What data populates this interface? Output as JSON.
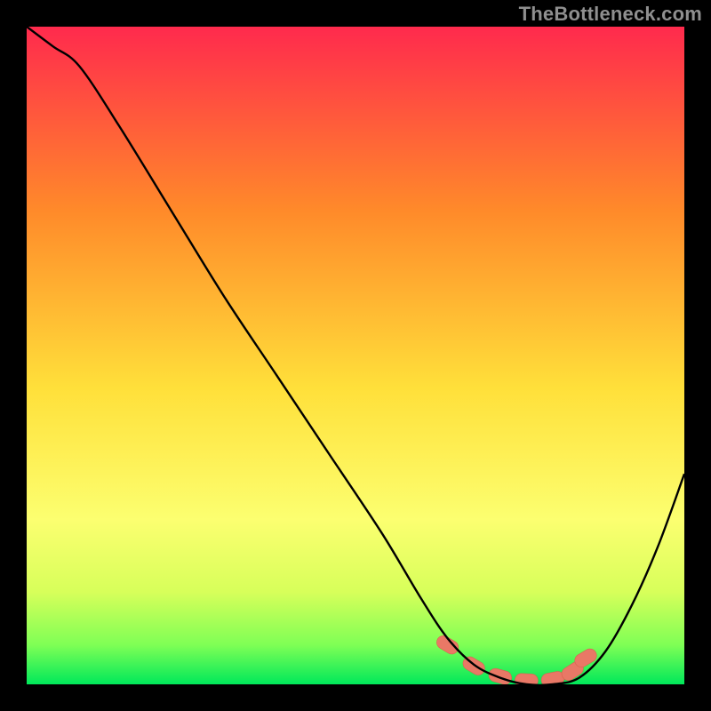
{
  "watermark": "TheBottleneck.com",
  "colors": {
    "background": "#000000",
    "gradient_top": "#ff2a4d",
    "gradient_mid1": "#ff8a2a",
    "gradient_mid2": "#ffe03a",
    "gradient_mid3": "#fcff70",
    "gradient_mid4": "#d7ff5a",
    "gradient_mid5": "#7fff55",
    "gradient_bottom": "#00e85a",
    "curve": "#000000",
    "marker_fill": "#e97866",
    "marker_stroke": "#d9634f"
  },
  "chart_data": {
    "type": "line",
    "title": "",
    "xlabel": "",
    "ylabel": "",
    "xlim": [
      0,
      100
    ],
    "ylim": [
      0,
      100
    ],
    "grid": false,
    "series": [
      {
        "name": "bottleneck-curve",
        "x": [
          0,
          4,
          8,
          14,
          22,
          30,
          38,
          46,
          54,
          60,
          64,
          68,
          72,
          76,
          80,
          84,
          88,
          92,
          96,
          100
        ],
        "values": [
          100,
          97,
          94,
          85,
          72,
          59,
          47,
          35,
          23,
          13,
          7,
          3,
          1,
          0,
          0,
          1,
          5,
          12,
          21,
          32
        ]
      }
    ],
    "markers": {
      "name": "highlight-band",
      "x": [
        64,
        68,
        72,
        76,
        80,
        83,
        85
      ],
      "values": [
        6.0,
        2.8,
        1.2,
        0.6,
        0.8,
        2.0,
        4.0
      ]
    }
  }
}
